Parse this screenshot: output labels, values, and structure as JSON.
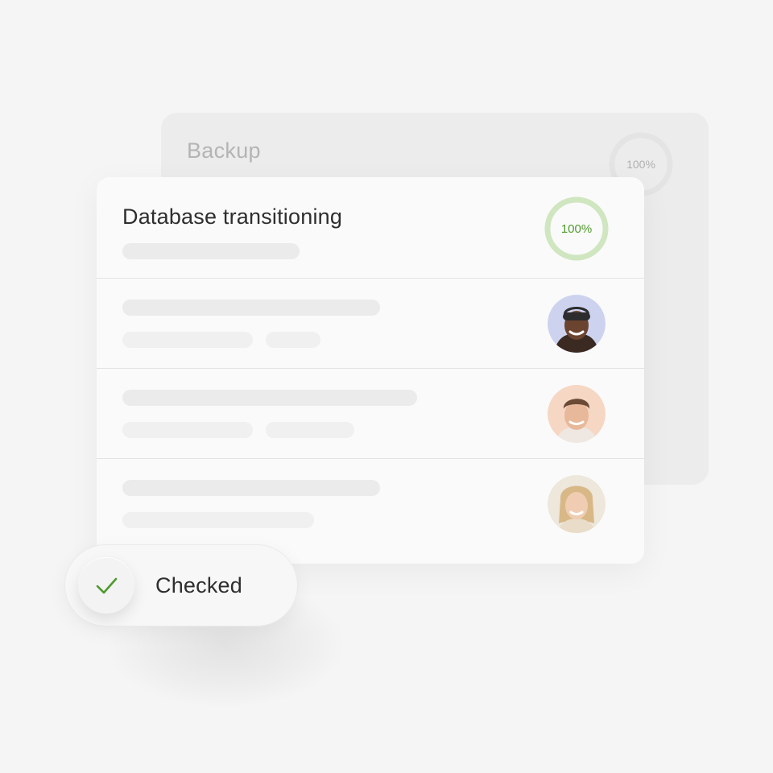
{
  "backup_card": {
    "title": "Backup",
    "progress": 1.0,
    "progress_label": "100%",
    "ring_color": "#e4e4e4"
  },
  "main_card": {
    "title": "Database transitioning",
    "progress": 1.0,
    "progress_label": "100%",
    "ring_color": "#cfe6c0",
    "ring_text_color": "#4f9a2e",
    "rows": [
      {
        "avatar": "avatar-person-1"
      },
      {
        "avatar": "avatar-person-2"
      },
      {
        "avatar": "avatar-person-3"
      }
    ]
  },
  "status_pill": {
    "icon": "checkmark-icon",
    "label": "Checked",
    "accent": "#4f9a2e"
  }
}
